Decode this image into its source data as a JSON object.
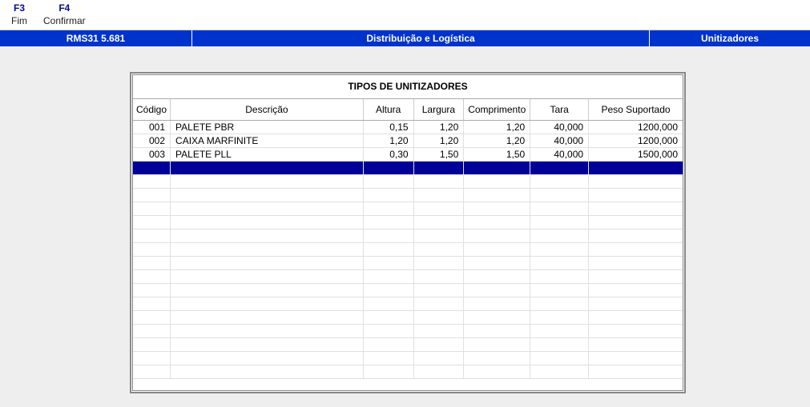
{
  "fkeys": [
    {
      "key": "F3",
      "label": "Fim"
    },
    {
      "key": "F4",
      "label": "Confirmar"
    }
  ],
  "titlebar": {
    "left": "RMS31 5.681",
    "mid": "Distribuição e Logística",
    "right": "Unitizadores"
  },
  "panel": {
    "title": "TIPOS DE UNITIZADORES",
    "columns": {
      "codigo": "Código",
      "descricao": "Descrição",
      "altura": "Altura",
      "largura": "Largura",
      "comprimento": "Comprimento",
      "tara": "Tara",
      "peso": "Peso Suportado"
    },
    "rows": [
      {
        "codigo": "001",
        "descricao": "PALETE PBR",
        "altura": "0,15",
        "largura": "1,20",
        "comprimento": "1,20",
        "tara": "40,000",
        "peso": "1200,000"
      },
      {
        "codigo": "002",
        "descricao": "CAIXA MARFINITE",
        "altura": "1,20",
        "largura": "1,20",
        "comprimento": "1,20",
        "tara": "40,000",
        "peso": "1200,000"
      },
      {
        "codigo": "003",
        "descricao": "PALETE PLL",
        "altura": "0,30",
        "largura": "1,50",
        "comprimento": "1,50",
        "tara": "40,000",
        "peso": "1500,000"
      }
    ],
    "selected_index": 3,
    "empty_rows": 15
  }
}
